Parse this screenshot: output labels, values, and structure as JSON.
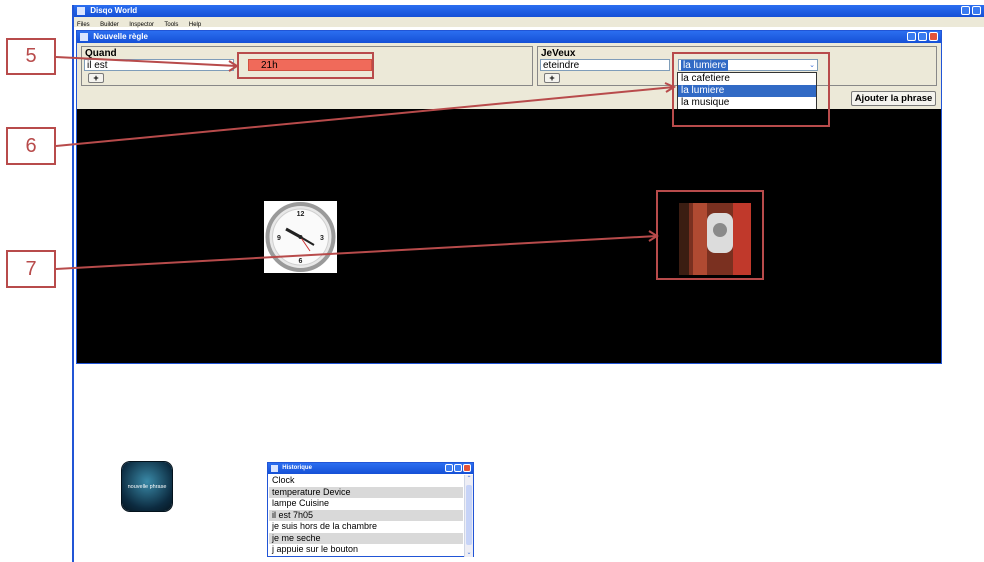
{
  "app": {
    "title": "Disqo World",
    "menu": [
      "Files",
      "Builder",
      "Inspector",
      "Tools",
      "Help"
    ]
  },
  "rule_window": {
    "title": "Nouvelle règle",
    "quand": {
      "header": "Quand",
      "subject": "il est",
      "value": "21h",
      "plus": "+"
    },
    "jeveux": {
      "header": "JeVeux",
      "action": "eteindre",
      "selected": "la lumiere",
      "options": [
        "la cafetiere",
        "la lumiere",
        "la musique"
      ],
      "plus": "+"
    },
    "add_button": "Ajouter la phrase"
  },
  "callouts": [
    "5",
    "6",
    "7"
  ],
  "icons": {
    "clock": "wall-clock-icon",
    "device": "lamp-photo-icon"
  },
  "new_phrase_button": "nouvelle phrase",
  "history": {
    "title": "Historique",
    "items": [
      "Clock",
      "temperature Device",
      "lampe Cuisine",
      "il est 7h05",
      "je suis hors de la chambre",
      "je me seche",
      "j appuie sur le bouton"
    ]
  },
  "colors": {
    "highlight": "#f06a5a",
    "selection": "#316ac5",
    "callout": "#b84b4b"
  }
}
